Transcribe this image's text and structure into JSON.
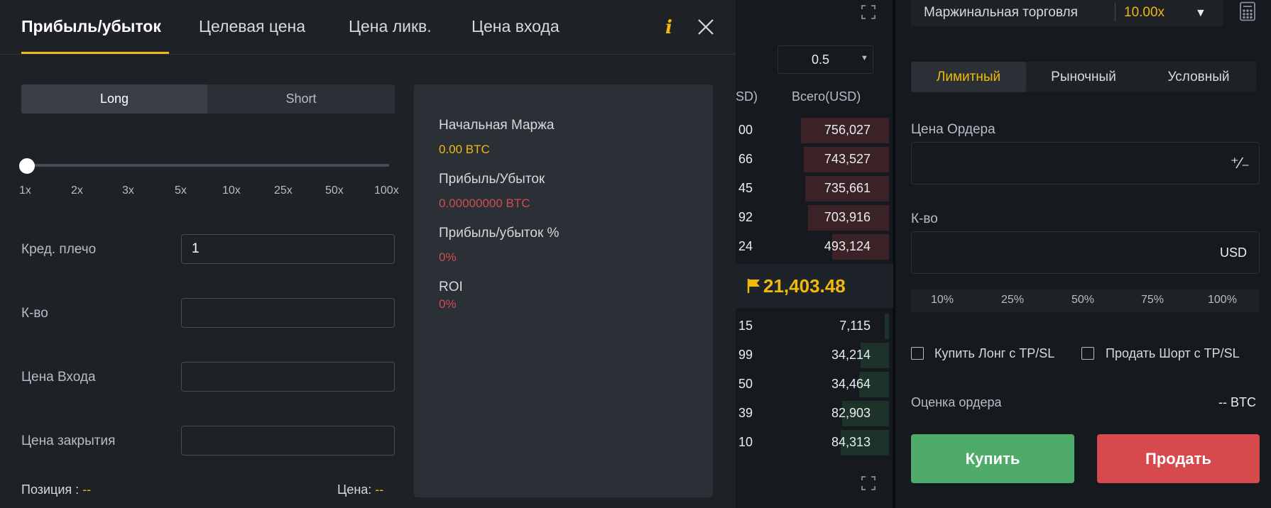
{
  "calculator": {
    "tabs": [
      "Прибыль/убыток",
      "Целевая цена",
      "Цена ликв.",
      "Цена входа"
    ],
    "active_tab": "Прибыль/убыток",
    "info_icon": "i",
    "side": {
      "long": "Long",
      "short": "Short",
      "selected": "Long"
    },
    "leverage_ticks": [
      "1x",
      "2x",
      "3x",
      "5x",
      "10x",
      "25x",
      "50x",
      "100x"
    ],
    "leverage_slider_value": "1x",
    "fields": {
      "leverage": {
        "label": "Кред. плечо",
        "value": "1"
      },
      "quantity": {
        "label": "К-во",
        "value": ""
      },
      "entry_price": {
        "label": "Цена Входа",
        "value": ""
      },
      "close_price": {
        "label": "Цена закрытия",
        "value": ""
      }
    },
    "position": {
      "label": "Позиция :",
      "value": "--"
    },
    "price": {
      "label": "Цена:",
      "value": "--"
    },
    "results": {
      "initial_margin": {
        "label": "Начальная Маржа",
        "value": "0.00 BTC"
      },
      "pnl": {
        "label": "Прибыль/Убыток",
        "value": "0.00000000 BTC"
      },
      "pnl_pct": {
        "label": "Прибыль/убыток %",
        "value": "0%"
      },
      "roi": {
        "label": "ROI",
        "value": "0%"
      }
    }
  },
  "orderbook": {
    "precision": "0.5",
    "header_left": "SD)",
    "header_total": "Всего(USD)",
    "asks": [
      {
        "left": "00",
        "total": "756,027"
      },
      {
        "left": "66",
        "total": "743,527"
      },
      {
        "left": "45",
        "total": "735,661"
      },
      {
        "left": "92",
        "total": "703,916"
      },
      {
        "left": "24",
        "total": "493,124"
      }
    ],
    "mid_price": "21,403.48",
    "bids": [
      {
        "left": "15",
        "total": "7,115"
      },
      {
        "left": "99",
        "total": "34,214"
      },
      {
        "left": "50",
        "total": "34,464"
      },
      {
        "left": "39",
        "total": "82,903"
      },
      {
        "left": "10",
        "total": "84,313"
      }
    ]
  },
  "order_form": {
    "margin_label": "Маржинальная торговля",
    "margin_value": "10.00x",
    "tabs": [
      "Лимитный",
      "Рыночный",
      "Условный"
    ],
    "active_tab": "Лимитный",
    "price_label": "Цена Ордера",
    "price_value": "",
    "qty_label": "К-во",
    "qty_value": "",
    "qty_unit": "USD",
    "percent_options": [
      "10%",
      "25%",
      "50%",
      "75%",
      "100%"
    ],
    "checkbox_buy": "Купить Лонг с TP/SL",
    "checkbox_sell": "Продать Шорт с TP/SL",
    "estimate_label": "Оценка ордера",
    "estimate_value": "-- BTC",
    "buy_label": "Купить",
    "sell_label": "Продать"
  },
  "colors": {
    "accent": "#f0b90b",
    "buy": "#4eab6a",
    "sell": "#d6494c",
    "loss_text": "#cf4e4e",
    "ask_bg": "#3a2227",
    "bid_bg": "#1d3329"
  }
}
